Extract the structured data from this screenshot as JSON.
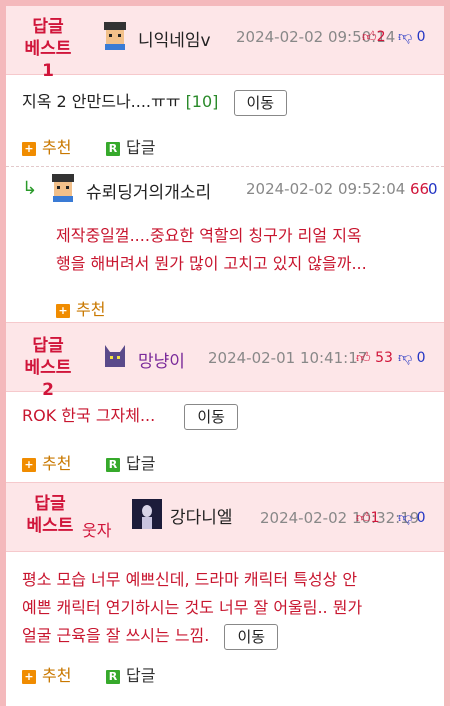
{
  "best1": {
    "label1": "답글",
    "label2": "베스트1",
    "nick": "니익네임v",
    "date": "2024-02-02 09:50:14",
    "up": "2",
    "down": "0",
    "body": "지옥 2 안만드나....ㅠㅠ",
    "count": "[10]",
    "move": "이동",
    "recommend": "추천",
    "reply": "답글"
  },
  "sub_reply": {
    "nick": "슈뢰딩거의개소리",
    "date": "2024-02-02 09:52:04",
    "up": "66",
    "down": "0",
    "line1": "제작중일껄....중요한 역할의 칭구가 리얼 지옥",
    "line2": "행을 해버려서 뭔가 많이 고치고 있지 않을까...",
    "recommend": "추천"
  },
  "best2": {
    "label1": "답글",
    "label2": "베스트2",
    "nick": "망냥이",
    "date": "2024-02-01 10:41:17",
    "up": "53",
    "down": "0",
    "body": "ROK 한국 그자체...",
    "move": "이동",
    "recommend": "추천",
    "reply": "답글"
  },
  "best3": {
    "label1": "답글",
    "label2": "베스트",
    "extra": "웃자",
    "nick": "강다니엘",
    "date": "2024-02-02 10:32:19",
    "up": "1",
    "down": "0",
    "line1": "평소 모습 너무 예쁘신데, 드라마 캐릭터 특성상 안",
    "line2": "예쁜 캐릭터 연기하시는 것도 너무 잘 어울림.. 뭔가",
    "line3": "얼굴 근육을 잘 쓰시는 느낌.",
    "move": "이동",
    "recommend": "추천",
    "reply": "답글"
  },
  "icons": {
    "thumb_up": "thumbs-up-icon",
    "thumb_down": "thumbs-down-icon",
    "plus": "plus-icon",
    "reply": "reply-icon"
  }
}
